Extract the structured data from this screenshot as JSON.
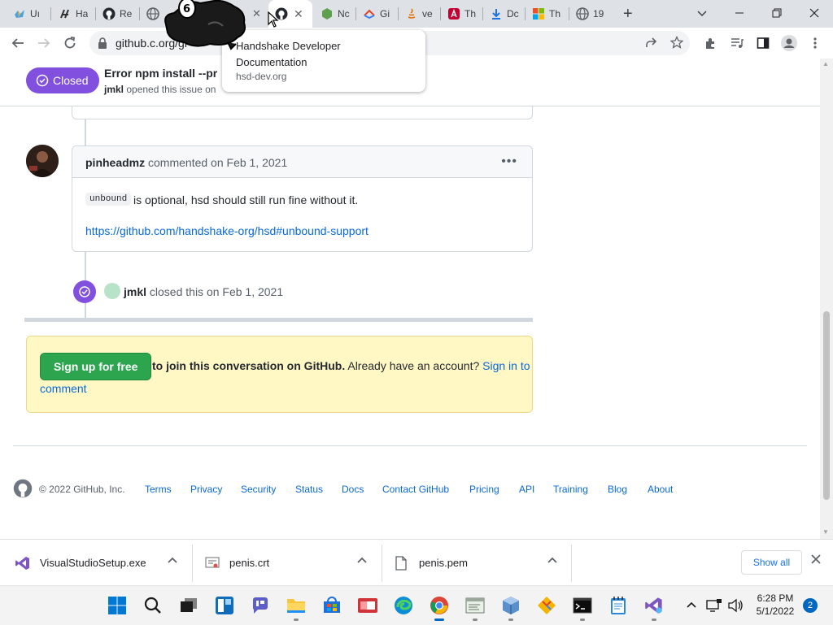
{
  "browser": {
    "tabs": [
      {
        "title": "Uı",
        "icon": "workspace-icon"
      },
      {
        "title": "Ha",
        "icon": "handshake-icon"
      },
      {
        "title": "Re",
        "icon": "github-icon"
      },
      {
        "title": "",
        "icon": "globe-icon"
      },
      {
        "title": "",
        "icon": "github-icon",
        "active": true
      },
      {
        "title": "Nc",
        "icon": "nodejs-icon"
      },
      {
        "title": "Gi",
        "icon": "gitbook-icon"
      },
      {
        "title": "ve",
        "icon": "java-icon"
      },
      {
        "title": "Th",
        "icon": "angular-icon"
      },
      {
        "title": "Dc",
        "icon": "download-icon"
      },
      {
        "title": "Th",
        "icon": "microsoft-icon"
      },
      {
        "title": "19",
        "icon": "globe-icon"
      }
    ],
    "url": "github.c.org/gi",
    "tooltip": {
      "title": "Handshake Developer Documentation",
      "host": "hsd-dev.org"
    }
  },
  "issue": {
    "state": "Closed",
    "title": "Error npm install --pr",
    "author": "jmkl",
    "meta_suffix": "opened this issue on"
  },
  "comment": {
    "author": "pinheadmz",
    "action": "commented on Feb 1, 2021",
    "code": "unbound",
    "text": "is optional, hsd should still run fine without it.",
    "link": "https://github.com/handshake-org/hsd#unbound-support"
  },
  "close_event": {
    "actor": "jmkl",
    "text": "closed this on Feb 1, 2021"
  },
  "signup": {
    "button": "Sign up for free",
    "bold_text": "to join this conversation on GitHub.",
    "text": "Already have an account?",
    "signin": "Sign in to",
    "signin_cont": "comment"
  },
  "footer": {
    "copyright": "© 2022 GitHub, Inc.",
    "links": [
      "Terms",
      "Privacy",
      "Security",
      "Status",
      "Docs",
      "Contact GitHub",
      "Pricing",
      "API",
      "Training",
      "Blog",
      "About"
    ]
  },
  "downloads": {
    "items": [
      {
        "name": "VisualStudioSetup.exe",
        "icon": "visual-studio-icon"
      },
      {
        "name": "penis.crt",
        "icon": "certificate-icon"
      },
      {
        "name": "penis.pem",
        "icon": "file-icon"
      }
    ],
    "show_all": "Show all"
  },
  "taskbar": {
    "time": "6:28 PM",
    "date": "5/1/2022",
    "notification_count": "2"
  },
  "scroll": {
    "position": 0.92
  }
}
